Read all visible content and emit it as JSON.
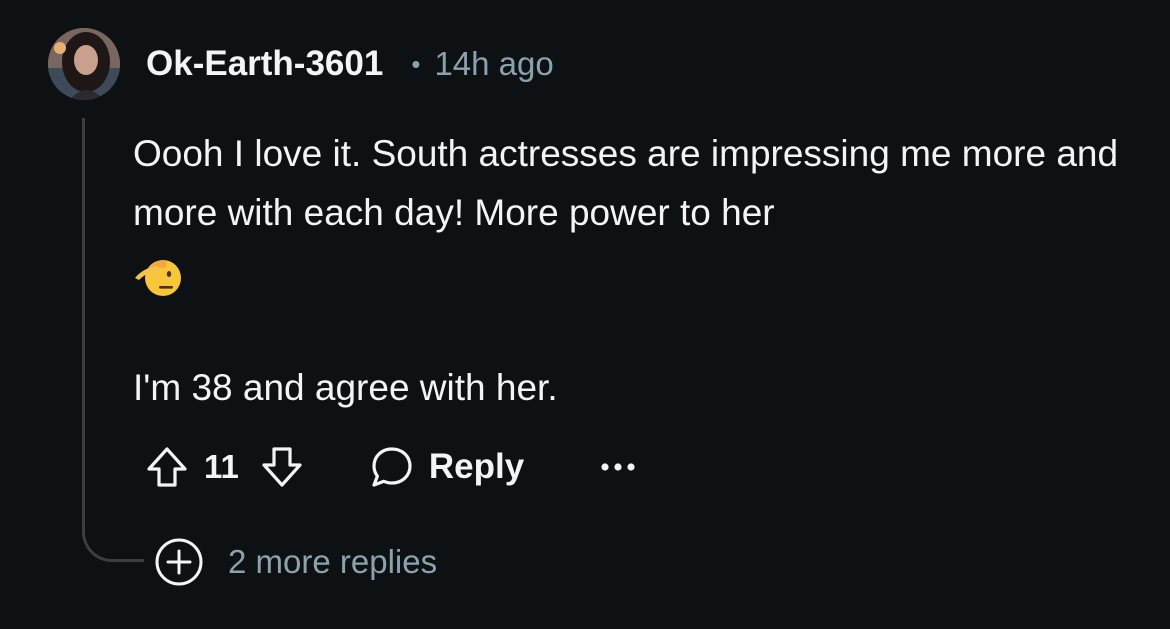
{
  "comment": {
    "username": "Ok-Earth-3601",
    "separator": "•",
    "timestamp": "14h ago",
    "body": {
      "line1": "Oooh I love it. South actresses are impressing me more and more with each day! More power to her",
      "emoji": "saluting-face-emoji",
      "line2": "I'm 38 and agree with her."
    },
    "votes": {
      "count": "11"
    },
    "reply_label": "Reply",
    "more_replies_label": "2 more replies"
  },
  "colors": {
    "background": "#0e1113",
    "text_primary": "#f2f4f5",
    "text_secondary": "#8ba2ad",
    "thread_line": "#3a3f43"
  },
  "icons": {
    "upvote": "arrow-up-icon",
    "downvote": "arrow-down-icon",
    "reply": "speech-bubble-icon",
    "more": "ellipsis-icon",
    "expand": "plus-circle-icon"
  }
}
